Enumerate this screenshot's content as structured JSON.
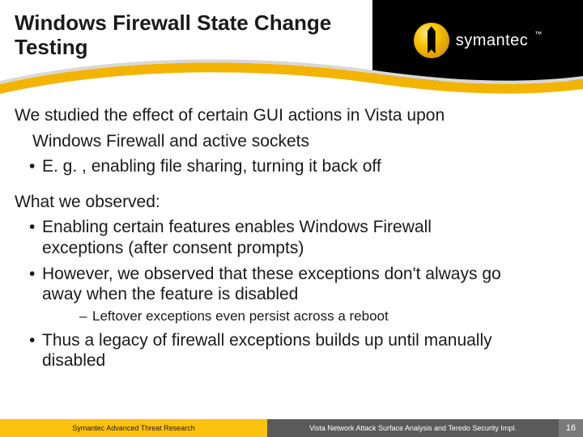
{
  "title": "Windows Firewall State Change Testing",
  "brand": {
    "name": "symantec",
    "tm": "™"
  },
  "body": {
    "intro_line1": "We studied the effect of certain GUI actions in Vista upon",
    "intro_line2": "Windows Firewall and active sockets",
    "intro_bullet": "E. g. , enabling file sharing, turning it back off",
    "observed_heading": "What we observed:",
    "obs1_l1": "Enabling certain features enables Windows Firewall",
    "obs1_l2": "exceptions (after consent prompts)",
    "obs2_l1": "However, we observed that these exceptions don't always go",
    "obs2_l2": "away when the feature is disabled",
    "obs2_sub": "Leftover exceptions even persist across a reboot",
    "obs3_l1": "Thus a legacy of firewall exceptions builds up until manually",
    "obs3_l2": "disabled"
  },
  "footer": {
    "left": "Symantec Advanced Threat Research",
    "right": "Vista Network Attack Surface Analysis and Teredo Security Impl.",
    "page": "16"
  }
}
